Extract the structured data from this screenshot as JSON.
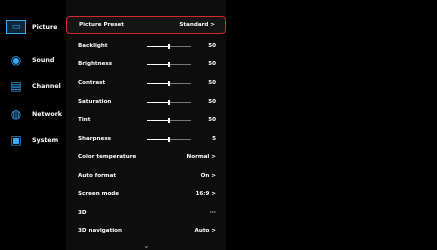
{
  "sidebar": {
    "items": [
      {
        "label": "Picture",
        "icon": "picture-icon",
        "active": true
      },
      {
        "label": "Sound",
        "icon": "speaker-icon",
        "active": false
      },
      {
        "label": "Channel",
        "icon": "channel-icon",
        "active": false
      },
      {
        "label": "Network",
        "icon": "globe-icon",
        "active": false
      },
      {
        "label": "System",
        "icon": "system-icon",
        "active": false
      }
    ]
  },
  "settings": [
    {
      "label": "Picture Preset",
      "value": "Standard >"
    },
    {
      "label": "Backlight",
      "value": "50",
      "level": 50
    },
    {
      "label": "Brightness",
      "value": "50",
      "level": 50
    },
    {
      "label": "Contrast",
      "value": "50",
      "level": 50
    },
    {
      "label": "Saturation",
      "value": "50",
      "level": 50
    },
    {
      "label": "Tint",
      "value": "50",
      "level": 50
    },
    {
      "label": "Sharpness",
      "value": "5",
      "level": 50
    },
    {
      "label": "Color temperature",
      "value": "Normal >"
    },
    {
      "label": "Auto format",
      "value": "On >"
    },
    {
      "label": "Screen mode",
      "value": "16:9 >"
    },
    {
      "label": "3D",
      "value": "···"
    },
    {
      "label": "3D navigation",
      "value": "Auto >"
    }
  ],
  "more_indicator": "⌄",
  "colors": {
    "accent": "#39a9ff",
    "selection": "#d6262d"
  }
}
